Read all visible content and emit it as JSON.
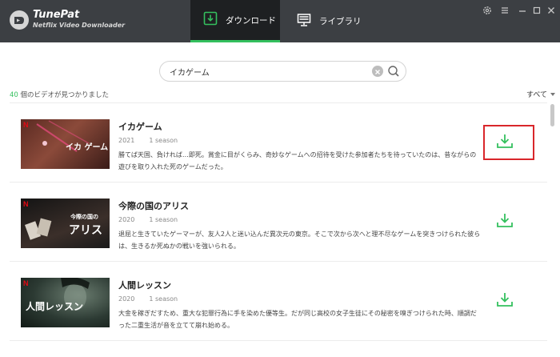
{
  "app": {
    "name": "TunePat",
    "subtitle": "Netflix Video Downloader"
  },
  "tabs": [
    {
      "label": "ダウンロード",
      "active": true,
      "icon": "download-tab-icon"
    },
    {
      "label": "ライブラリ",
      "active": false,
      "icon": "library-monitor-icon"
    }
  ],
  "window_controls": [
    "settings-gear-icon",
    "menu-icon",
    "minimize-icon",
    "maximize-icon",
    "close-icon"
  ],
  "search": {
    "value": "イカゲーム"
  },
  "results": {
    "count": "40",
    "count_suffix": " 個のビデオが見つかりました"
  },
  "filter": {
    "label": "すべて"
  },
  "colors": {
    "accent": "#34c05e",
    "titlebar": "#3c3f43",
    "highlight": "#d9262b",
    "netflix_red": "#e50914"
  },
  "items": [
    {
      "title": "イカゲーム",
      "year": "2021",
      "season": "1 season",
      "description": "勝てば天国、負ければ…即死。賞金に目がくらみ、奇妙なゲームへの招待を受けた参加者たちを待っていたのは、昔ながらの遊びを取り入れた死のゲームだった。",
      "thumb_logo": "N",
      "thumb_text": "イカ ゲーム",
      "highlighted": true
    },
    {
      "title": "今際の国のアリス",
      "year": "2020",
      "season": "1 season",
      "description": "退屈と生きていたゲーマーが、友人2人と迷い込んだ異次元の東京。そこで次から次へと理不尽なゲームを突きつけられた彼らは、生きるか死ぬかの戦いを強いられる。",
      "thumb_logo": "N",
      "thumb_text": "アリス",
      "thumb_small": "今際の国の",
      "highlighted": false
    },
    {
      "title": "人間レッスン",
      "year": "2020",
      "season": "1 season",
      "description": "大金を稼ぎだすため、重大な犯罪行為に手を染めた優等生。だが同じ高校の女子生徒にその秘密を嗅ぎつけられた時、順調だった二重生活が音を立てて崩れ始める。",
      "thumb_logo": "N",
      "thumb_text": "人間レッスン",
      "highlighted": false
    }
  ]
}
